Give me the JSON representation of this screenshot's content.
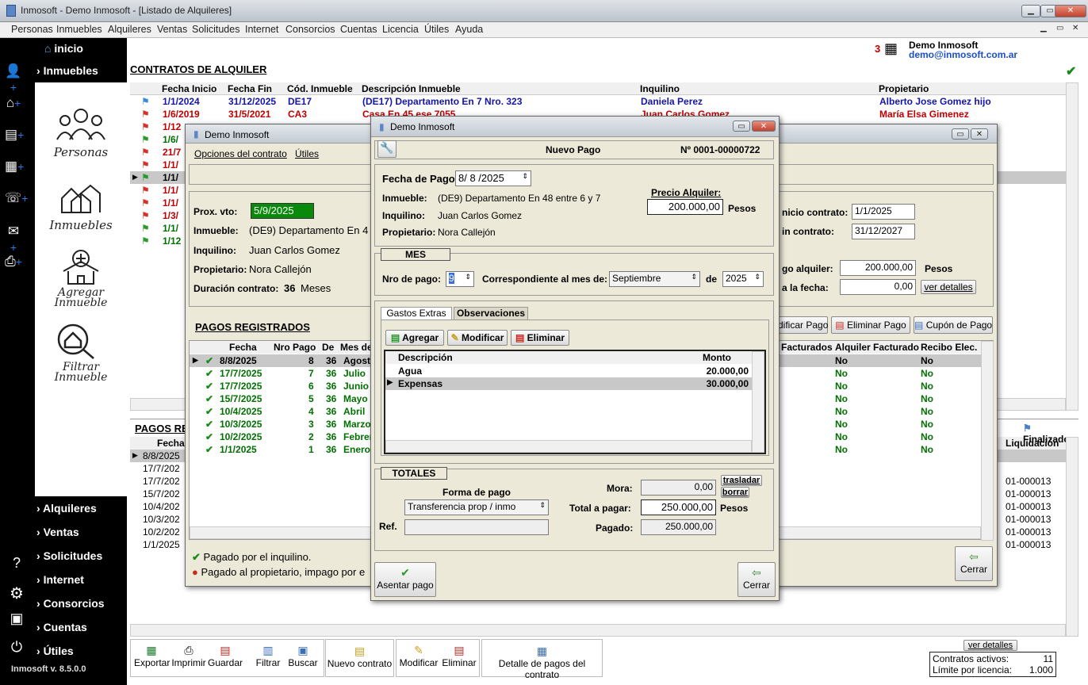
{
  "app": {
    "title": "Inmosoft - Demo Inmosoft - [Listado de Alquileres]",
    "version": "Inmosoft v. 8.5.0.0"
  },
  "menu": [
    "Personas",
    "Inmuebles",
    "Alquileres",
    "Ventas",
    "Solicitudes",
    "Internet",
    "Consorcios",
    "Cuentas",
    "Licencia",
    "Útiles",
    "Ayuda"
  ],
  "sidebar": {
    "inicio": "inicio",
    "inmuebles": "Inmuebles",
    "tiles": [
      "Personas",
      "Inmuebles",
      "Agregar Inmueble",
      "Filtrar Inmueble"
    ],
    "bottom": [
      "Alquileres",
      "Ventas",
      "Solicitudes",
      "Internet",
      "Consorcios",
      "Cuentas",
      "Útiles"
    ]
  },
  "header": {
    "section": "CONTRATOS DE ALQUILER",
    "company": "Demo Inmosoft",
    "email": "demo@inmosoft.com.ar",
    "count": "3"
  },
  "contracts": {
    "columns": [
      "Fecha Inicio",
      "Fecha Fin",
      "Cód. Inmueble",
      "Descripción Inmueble",
      "Inquilino",
      "Propietario"
    ],
    "rows": [
      {
        "inicio": "1/1/2024",
        "fin": "31/12/2025",
        "cod": "DE17",
        "desc": "(DE17) Departamento En 7 Nro. 323",
        "inq": "Daniela Perez",
        "prop": "Alberto Jose Gomez hijo",
        "color": "blue"
      },
      {
        "inicio": "1/6/2019",
        "fin": "31/5/2021",
        "cod": "CA3",
        "desc": "Casa En 45 ese 7055",
        "inq": "Juan Carlos Gomez",
        "prop": "María Elsa Gimenez",
        "color": "red"
      },
      {
        "inicio": "1/12",
        "color": "red"
      },
      {
        "inicio": "1/6/",
        "color": "green"
      },
      {
        "inicio": "21/7",
        "color": "red"
      },
      {
        "inicio": "1/1/",
        "color": "red"
      },
      {
        "inicio": "1/1/",
        "color": "black"
      },
      {
        "inicio": "1/1/",
        "color": "red"
      },
      {
        "inicio": "1/1/",
        "color": "red"
      },
      {
        "inicio": "1/3/",
        "color": "red"
      },
      {
        "inicio": "1/1/",
        "color": "green"
      },
      {
        "inicio": "1/12",
        "color": "green"
      }
    ]
  },
  "contractWin": {
    "title": "Demo Inmosoft",
    "menu": [
      "Opciones del contrato",
      "Útiles"
    ],
    "proxVto_label": "Prox. vto:",
    "proxVto": "5/9/2025",
    "inmueble_label": "Inmueble:",
    "inmueble": "(DE9) Departamento En 4",
    "inquilino_label": "Inquilino:",
    "inquilino": "Juan Carlos Gomez",
    "propietario_label": "Propietario:",
    "propietario": "Nora Callejón",
    "duracion_label": "Duración contrato:",
    "duracion": "36",
    "duracion_unit": "Meses",
    "inicio_label": "nicio contrato:",
    "inicio": "1/1/2025",
    "fin_label": "in contrato:",
    "fin": "31/12/2027",
    "pagoalq_label": "go alquiler:",
    "pagoalq": "200.000,00",
    "pesos": "Pesos",
    "fecha_label": "a la fecha:",
    "fecha": "0,00",
    "ver": "ver detalles",
    "pagos_title": "PAGOS REGISTRADOS",
    "buttons": [
      "dificar Pago",
      "Eliminar Pago",
      "Cupón de Pago"
    ],
    "cerrar": "Cerrar",
    "cols": [
      "Fecha",
      "Nro Pago",
      "De",
      "Mes de"
    ],
    "cols2": [
      "Facturados",
      "Alquiler Facturado",
      "Recibo Elec."
    ],
    "pagos": [
      {
        "f": "8/8/2025",
        "n": "8",
        "d": "36",
        "m": "Agosto",
        "a": "No",
        "r": "No"
      },
      {
        "f": "17/7/2025",
        "n": "7",
        "d": "36",
        "m": "Julio",
        "a": "No",
        "r": "No"
      },
      {
        "f": "17/7/2025",
        "n": "6",
        "d": "36",
        "m": "Junio",
        "a": "No",
        "r": "No"
      },
      {
        "f": "15/7/2025",
        "n": "5",
        "d": "36",
        "m": "Mayo",
        "a": "No",
        "r": "No"
      },
      {
        "f": "10/4/2025",
        "n": "4",
        "d": "36",
        "m": "Abril",
        "a": "No",
        "r": "No"
      },
      {
        "f": "10/3/2025",
        "n": "3",
        "d": "36",
        "m": "Marzo",
        "a": "No",
        "r": "No"
      },
      {
        "f": "10/2/2025",
        "n": "2",
        "d": "36",
        "m": "Febrer",
        "a": "No",
        "r": "No"
      },
      {
        "f": "1/1/2025",
        "n": "1",
        "d": "36",
        "m": "Enero",
        "a": "No",
        "r": "No"
      }
    ],
    "legend1": "Pagado por el inquilino.",
    "legend2": "Pagado al propietario, impago por e"
  },
  "pagosBottom": {
    "title": "PAGOS RE",
    "col": "Fecha",
    "liq": "Liquidación",
    "finalizado": "Finalizado",
    "dates": [
      "8/8/2025",
      "17/7/202",
      "17/7/202",
      "15/7/202",
      "10/4/202",
      "10/3/202",
      "10/2/202",
      "1/1/2025"
    ],
    "liqs": [
      "",
      "",
      "1-000013",
      "1-000013",
      "1-000013",
      "1-000013",
      "1-000013",
      "1-000013"
    ]
  },
  "toolbar": {
    "buttons": [
      "Exportar",
      "Imprimir",
      "Guardar",
      "Filtrar",
      "Buscar",
      "Nuevo contrato",
      "Modificar",
      "Eliminar",
      "Detalle de pagos del contrato"
    ]
  },
  "footer": {
    "ver": "ver detalles",
    "activos_label": "Contratos activos:",
    "activos": "11",
    "limite_label": "Límite por licencia:",
    "limite": "1.000"
  },
  "pago": {
    "title": "Demo Inmosoft",
    "heading": "Nuevo Pago",
    "numero": "Nº 0001-00000722",
    "fecha_label": "Fecha de Pago:",
    "fecha": "8/ 8 /2025",
    "inmueble_label": "Inmueble:",
    "inmueble": "(DE9) Departamento En 48 entre 6 y 7",
    "inquilino_label": "Inquilino:",
    "inquilino": "Juan Carlos Gomez",
    "propietario_label": "Propietario:",
    "propietario": "Nora Callejón",
    "precio_label": "Precio Alquiler:",
    "precio": "200.000,00",
    "pesos": "Pesos",
    "mes_title": "MES",
    "nro_label": "Nro de pago:",
    "nro": "9",
    "corresp_label": "Correspondiente al mes de:",
    "mes": "Septiembre",
    "de": "de",
    "anio": "2025",
    "tabs": [
      "Gastos Extras",
      "Observaciones"
    ],
    "btns": [
      "Agregar",
      "Modificar",
      "Eliminar"
    ],
    "gcols": [
      "Descripción",
      "Monto"
    ],
    "gastos": [
      {
        "d": "Agua",
        "m": "20.000,00"
      },
      {
        "d": "Expensas",
        "m": "30.000,00"
      }
    ],
    "totales": "TOTALES",
    "forma_label": "Forma de pago",
    "forma": "Transferencia prop / inmo",
    "ref_label": "Ref.",
    "mora_label": "Mora:",
    "mora": "0,00",
    "trasladar": "trasladar",
    "borrar": "borrar",
    "total_label": "Total a pagar:",
    "total": "250.000,00",
    "pagado_label": "Pagado:",
    "pagado": "250.000,00",
    "asentar": "Asentar pago",
    "cerrar": "Cerrar"
  }
}
